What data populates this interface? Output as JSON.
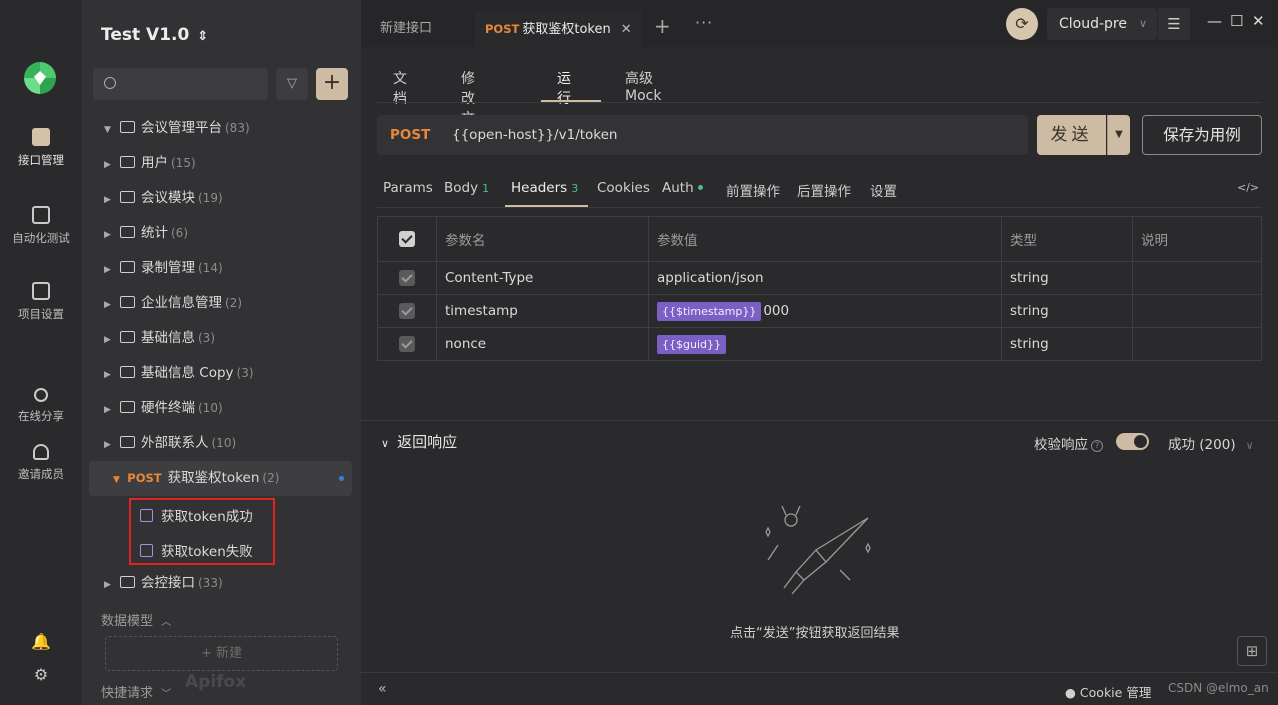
{
  "rail": {
    "items": [
      {
        "label": "接口管理",
        "icon": "api-management-icon"
      },
      {
        "label": "自动化测试",
        "icon": "automation-test-icon"
      },
      {
        "label": "项目设置",
        "icon": "project-settings-icon"
      },
      {
        "label": "在线分享",
        "icon": "share-icon"
      },
      {
        "label": "邀请成员",
        "icon": "invite-member-icon"
      }
    ]
  },
  "sidebar": {
    "project_title": "Test V1.0",
    "search_placeholder": "",
    "tree": [
      {
        "label": "会议管理平台",
        "count": "(83)"
      },
      {
        "label": "用户",
        "count": "(15)"
      },
      {
        "label": "会议模块",
        "count": "(19)"
      },
      {
        "label": "统计",
        "count": "(6)"
      },
      {
        "label": "录制管理",
        "count": "(14)"
      },
      {
        "label": "企业信息管理",
        "count": "(2)"
      },
      {
        "label": "基础信息",
        "count": "(3)"
      },
      {
        "label": "基础信息 Copy",
        "count": "(3)"
      },
      {
        "label": "硬件终端",
        "count": "(10)"
      },
      {
        "label": "外部联系人",
        "count": "(10)"
      },
      {
        "method": "POST",
        "label": "获取鉴权token",
        "count": "(2)"
      },
      {
        "label": "会控接口",
        "count": "(33)"
      }
    ],
    "cases": [
      "获取token成功",
      "获取token失败"
    ],
    "data_model_label": "数据模型",
    "new_label": "+ 新建",
    "quick_request_label": "快捷请求",
    "brand_watermark": "Apifox"
  },
  "tabs": [
    {
      "label": "新建接口"
    },
    {
      "method": "POST",
      "label": "获取鉴权token"
    }
  ],
  "env": {
    "selected": "Cloud-pre"
  },
  "subtabs": [
    "文档",
    "修改文档",
    "运行",
    "高级 Mock"
  ],
  "request": {
    "method": "POST",
    "url": "{{open-host}}/v1/token",
    "send_label": "发送",
    "save_label": "保存为用例"
  },
  "param_tabs": [
    {
      "label": "Params"
    },
    {
      "label": "Body",
      "count": "1"
    },
    {
      "label": "Headers",
      "count": "3"
    },
    {
      "label": "Cookies"
    },
    {
      "label": "Auth"
    },
    {
      "label": "前置操作"
    },
    {
      "label": "后置操作"
    },
    {
      "label": "设置"
    }
  ],
  "headers_table": {
    "columns": [
      "参数名",
      "参数值",
      "类型",
      "说明"
    ],
    "rows": [
      {
        "name": "Content-Type",
        "value_text": "application/json",
        "type": "string",
        "desc": ""
      },
      {
        "name": "timestamp",
        "value_tag": "{{$timestamp}}",
        "value_text": "000",
        "type": "string",
        "desc": ""
      },
      {
        "name": "nonce",
        "value_tag": "{{$guid}}",
        "value_text": "",
        "type": "string",
        "desc": ""
      }
    ]
  },
  "response": {
    "title": "返回响应",
    "verify_label": "校验响应",
    "status": "成功 (200)",
    "empty_text": "点击“发送”按钮获取返回结果"
  },
  "bottombar": {
    "cookie_label": "Cookie 管理",
    "csdn": "CSDN @elmo_an"
  },
  "colors": {
    "accent": "#cdbca3",
    "method_post": "#e8883a",
    "variable_tag": "#7b5fc4",
    "highlight_box": "#e02424"
  }
}
